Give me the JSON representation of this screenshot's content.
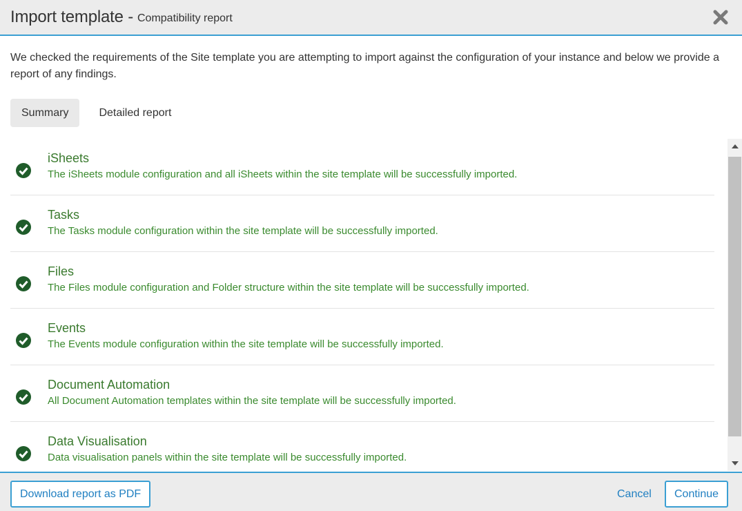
{
  "header": {
    "title": "Import template -",
    "subtitle": "Compatibility report"
  },
  "intro": "We checked the requirements of the Site template you are attempting to import against the configuration of your instance and below we provide a report of any findings.",
  "tabs": [
    {
      "label": "Summary",
      "active": true
    },
    {
      "label": "Detailed report",
      "active": false
    }
  ],
  "items": [
    {
      "name": "iSheets",
      "desc": "The iSheets module configuration and all iSheets within the site template will be successfully imported.",
      "status": "success"
    },
    {
      "name": "Tasks",
      "desc": "The Tasks module configuration within the site template will be successfully imported.",
      "status": "success"
    },
    {
      "name": "Files",
      "desc": "The Files module configuration and Folder structure within the site template will be successfully imported.",
      "status": "success"
    },
    {
      "name": "Events",
      "desc": "The Events module configuration within the site template will be successfully imported.",
      "status": "success"
    },
    {
      "name": "Document Automation",
      "desc": "All Document Automation templates within the site template will be successfully imported.",
      "status": "success"
    },
    {
      "name": "Data Visualisation",
      "desc": "Data visualisation panels within the site template will be successfully imported.",
      "status": "success"
    }
  ],
  "footer": {
    "download_label": "Download report as PDF",
    "cancel_label": "Cancel",
    "continue_label": "Continue"
  },
  "colors": {
    "accent": "#3a9fd3",
    "success": "#1f5c2a",
    "success_text": "#3a7a2e"
  },
  "icons": {
    "close": "close-icon",
    "check": "check-circle-icon",
    "scroll_up": "scroll-up-arrow-icon",
    "scroll_down": "scroll-down-arrow-icon"
  }
}
